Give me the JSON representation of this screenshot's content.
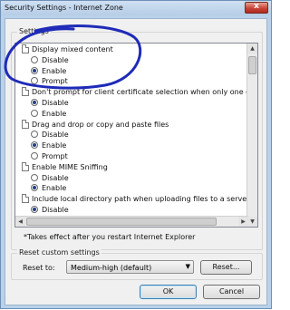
{
  "window": {
    "title": "Security Settings - Internet Zone",
    "close_label": "x"
  },
  "settings_group": {
    "label": "Settings"
  },
  "settings_list": {
    "categories": [
      {
        "label": "Display mixed content",
        "options": [
          {
            "label": "Disable",
            "selected": false
          },
          {
            "label": "Enable",
            "selected": true
          },
          {
            "label": "Prompt",
            "selected": false
          }
        ]
      },
      {
        "label": "Don't prompt for client certificate selection when only one ce",
        "options": [
          {
            "label": "Disable",
            "selected": true
          },
          {
            "label": "Enable",
            "selected": false
          }
        ]
      },
      {
        "label": "Drag and drop or copy and paste files",
        "options": [
          {
            "label": "Disable",
            "selected": false
          },
          {
            "label": "Enable",
            "selected": true
          },
          {
            "label": "Prompt",
            "selected": false
          }
        ]
      },
      {
        "label": "Enable MIME Sniffing",
        "options": [
          {
            "label": "Disable",
            "selected": false
          },
          {
            "label": "Enable",
            "selected": true
          }
        ]
      },
      {
        "label": "Include local directory path when uploading files to a server",
        "options": [
          {
            "label": "Disable",
            "selected": true
          }
        ]
      }
    ]
  },
  "note": "*Takes effect after you restart Internet Explorer",
  "reset_group": {
    "label": "Reset custom settings",
    "reset_to_label": "Reset to:",
    "select_value": "Medium-high (default)",
    "reset_button": "Reset..."
  },
  "footer": {
    "ok_label": "OK",
    "cancel_label": "Cancel"
  },
  "colors": {
    "annotation": "#1f2bb8",
    "title_bar": "#b9d1ea"
  }
}
